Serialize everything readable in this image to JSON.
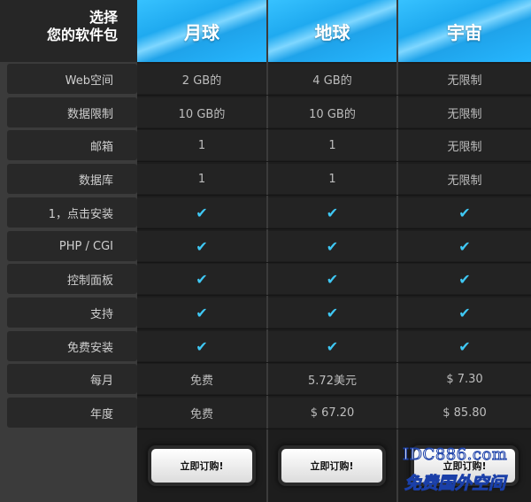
{
  "corner": {
    "line1": "选择",
    "line2": "您的软件包"
  },
  "plans": [
    {
      "name": "月球",
      "button": "立即订购!"
    },
    {
      "name": "地球",
      "button": "立即订购!"
    },
    {
      "name": "宇宙",
      "button": "立即订购!"
    }
  ],
  "rows": [
    {
      "label": "Web空间",
      "values": [
        "2 GB的",
        "4 GB的",
        "无限制"
      ]
    },
    {
      "label": "数据限制",
      "values": [
        "10 GB的",
        "10 GB的",
        "无限制"
      ]
    },
    {
      "label": "邮箱",
      "values": [
        "1",
        "1",
        "无限制"
      ]
    },
    {
      "label": "数据库",
      "values": [
        "1",
        "1",
        "无限制"
      ]
    },
    {
      "label": "1，点击安装",
      "values": [
        "✔",
        "✔",
        "✔"
      ]
    },
    {
      "label": "PHP / CGI",
      "values": [
        "✔",
        "✔",
        "✔"
      ]
    },
    {
      "label": "控制面板",
      "values": [
        "✔",
        "✔",
        "✔"
      ]
    },
    {
      "label": "支持",
      "values": [
        "✔",
        "✔",
        "✔"
      ]
    },
    {
      "label": "免费安装",
      "values": [
        "✔",
        "✔",
        "✔"
      ]
    },
    {
      "label": "每月",
      "values": [
        "免费",
        "5.72美元",
        "$ 7.30"
      ]
    },
    {
      "label": "年度",
      "values": [
        "免费",
        "$ 67.20",
        "$ 85.80"
      ]
    }
  ],
  "watermark": {
    "line1": "IDC886.com",
    "line2": "免费国外空间"
  },
  "colors": {
    "accent": "#26b7ff",
    "check": "#3fc8f4",
    "background": "#3b3b3b"
  }
}
